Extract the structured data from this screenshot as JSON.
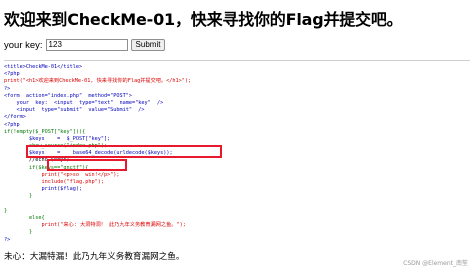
{
  "page": {
    "heading": "欢迎来到CheckMe-01，快来寻找你的Flag并提交吧。"
  },
  "form": {
    "label": "your key:",
    "input_value": "123",
    "submit_label": "Submit"
  },
  "source_lines": [
    "<title>CheckMe-01</title>",
    "<?php",
    "print(\"<h1>欢迎来到CheckMe-01, 快来寻找你的Flag并提交吧。</h1>\");",
    "?>",
    "<form  action=\"index.php\"  method=\"POST\">",
    "    your  key:  <input  type=\"text\"  name=\"key\"  />",
    "    <input  type=\"submit\"  value=\"Submit\"  />",
    "</form>",
    "<?php",
    "if(!empty($_POST[\"key\"])){",
    "        $keys    =  $_POST[\"key\"];",
    "        show_source(\"index.php\");",
    "        $keys    =    base64_decode(urldecode($keys));",
    "        //echo $keys;",
    "        if($keys==\"qnctf\"){",
    "            print(\"<p>so  win!</p>\");",
    "            include(\"flag.php\");",
    "            print($flag);",
    "        }",
    "",
    "}",
    "        else{",
    "            print(\"来心: 大洞特洞！ 此乃九年义务教育漏网之鱼。\");",
    "        }",
    "?>"
  ],
  "output_text": "未心：大漏特漏！此乃九年义务教育漏网之鱼。",
  "watermark": "CSDN @Element_南笙",
  "colors": {
    "highlight_border": "#e8192c",
    "php_keyword": "#007700",
    "php_string": "#dd0000",
    "php_default": "#0000bb"
  }
}
